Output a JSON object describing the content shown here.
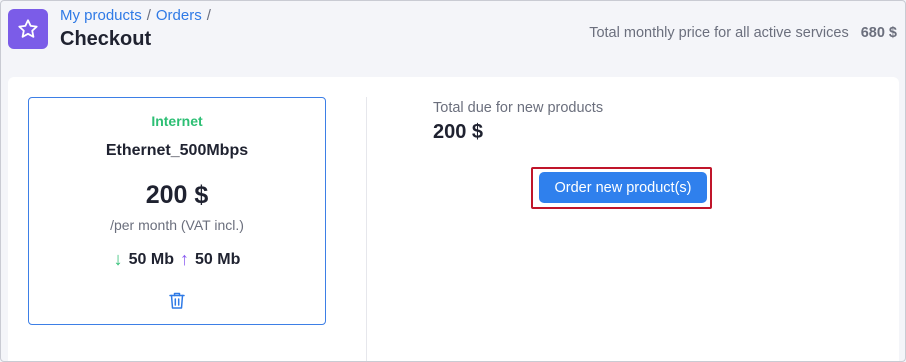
{
  "breadcrumb": {
    "items": [
      "My products",
      "Orders"
    ],
    "separator": "/"
  },
  "header": {
    "title": "Checkout",
    "icon": "star-icon",
    "total_monthly_label": "Total monthly price for all active services",
    "total_monthly_amount": "680 $"
  },
  "product": {
    "category": "Internet",
    "name": "Ethernet_500Mbps",
    "price": "200 $",
    "period": "/per month (VAT incl.)",
    "download": "50 Mb",
    "upload": "50 Mb",
    "delete_icon": "trash-icon"
  },
  "summary": {
    "due_label": "Total due for new products",
    "due_amount": "200 $",
    "order_button_label": "Order new product(s)"
  },
  "colors": {
    "accent": "#2f80ed",
    "star_box": "#7b5ce8",
    "category_green": "#2dbf74",
    "upload_purple": "#8a5cf0",
    "highlight_red": "#c0152a"
  }
}
